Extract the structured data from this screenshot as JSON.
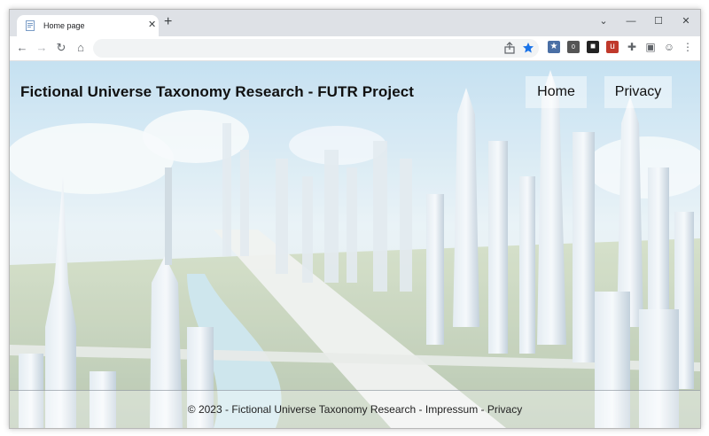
{
  "browser": {
    "tab_title": "Home page",
    "tab_close": "✕",
    "new_tab": "+",
    "window_controls": {
      "collapse": "⌄",
      "minimize": "—",
      "maximize": "☐",
      "close": "✕"
    },
    "nav": {
      "back": "←",
      "forward": "→",
      "reload": "↻",
      "home": "⌂"
    },
    "omnibox": {
      "value": "",
      "share_icon": "share-icon",
      "bookmark_icon": "star-icon"
    },
    "extension_badge": "0"
  },
  "site": {
    "title": "Fictional Universe Taxonomy Research - FUTR Project",
    "nav": [
      {
        "label": "Home"
      },
      {
        "label": "Privacy"
      }
    ],
    "footer": {
      "copyright": "© 2023 - Fictional Universe Taxonomy Research",
      "separator": " - ",
      "impressum": "Impressum",
      "privacy": "Privacy"
    }
  },
  "colors": {
    "tabstrip": "#dee1e6",
    "bookmark_star": "#1a73e8",
    "sky": "#cfe6f5"
  }
}
